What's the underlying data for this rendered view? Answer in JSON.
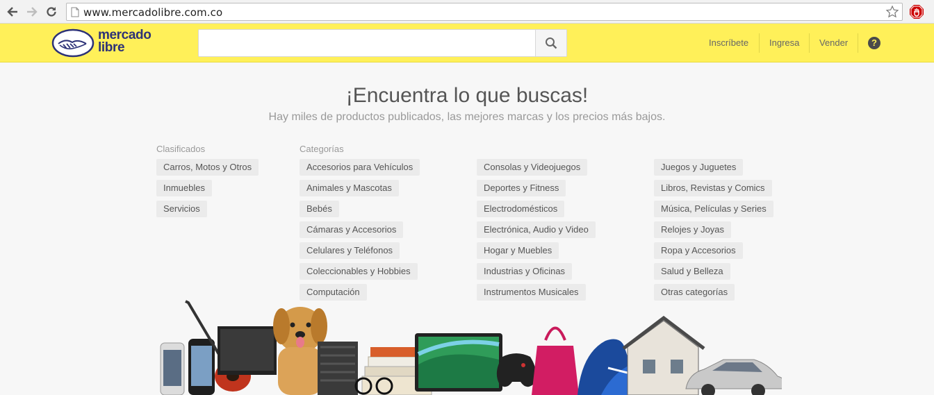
{
  "browser": {
    "url": "www.mercadolibre.com.co"
  },
  "header": {
    "logo_line1": "mercado",
    "logo_line2": "libre",
    "search_placeholder": "",
    "nav": {
      "signup": "Inscríbete",
      "login": "Ingresa",
      "sell": "Vender",
      "help": "?"
    }
  },
  "hero": {
    "title": "¡Encuentra lo que buscas!",
    "subtitle": "Hay miles de productos publicados, las mejores marcas y los precios más bajos."
  },
  "clasificados": {
    "heading": "Clasificados",
    "items": [
      "Carros, Motos y Otros",
      "Inmuebles",
      "Servicios"
    ]
  },
  "categorias": {
    "heading": "Categorías",
    "col1": [
      "Accesorios para Vehículos",
      "Animales y Mascotas",
      "Bebés",
      "Cámaras y Accesorios",
      "Celulares y Teléfonos",
      "Coleccionables y Hobbies",
      "Computación"
    ],
    "col2": [
      "Consolas y Videojuegos",
      "Deportes y Fitness",
      "Electrodomésticos",
      "Electrónica, Audio y Video",
      "Hogar y Muebles",
      "Industrias y Oficinas",
      "Instrumentos Musicales"
    ],
    "col3": [
      "Juegos y Juguetes",
      "Libros, Revistas y Comics",
      "Música, Películas y Series",
      "Relojes y Joyas",
      "Ropa y Accesorios",
      "Salud y Belleza",
      "Otras categorías"
    ]
  },
  "colors": {
    "brand_yellow": "#fff059",
    "brand_blue": "#2d3277"
  }
}
